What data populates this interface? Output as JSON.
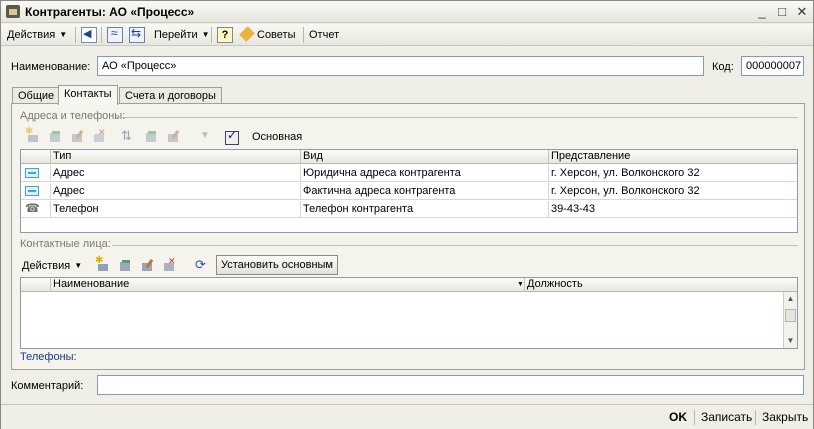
{
  "window": {
    "title": "Контрагенты: АО «Процесс»"
  },
  "toolbar": {
    "actions_label": "Действия",
    "goto_label": "Перейти",
    "help_label": "?",
    "tips_label": "Советы",
    "report_label": "Отчет"
  },
  "form": {
    "name_label": "Наименование:",
    "name_value": "АО «Процесс»",
    "code_label": "Код:",
    "code_value": "000000007",
    "comment_label": "Комментарий:",
    "comment_value": ""
  },
  "tabs": [
    {
      "label": "Общие"
    },
    {
      "label": "Контакты"
    },
    {
      "label": "Счета и договоры"
    }
  ],
  "addresses": {
    "group_title": "Адреса и телефоны:",
    "main_label": "Основная",
    "columns": [
      "Тип",
      "Вид",
      "Представление"
    ],
    "rows": [
      {
        "icon": "address-icon",
        "type": "Адрес",
        "kind": "Юридична адреса контрагента",
        "value": "г. Херсон, ул. Волконского 32"
      },
      {
        "icon": "address-icon",
        "type": "Адрес",
        "kind": "Фактична адреса контрагента",
        "value": "г. Херсон, ул. Волконского 32"
      },
      {
        "icon": "phone-icon",
        "type": "Телефон",
        "kind": "Телефон контрагента",
        "value": "39-43-43"
      }
    ]
  },
  "contacts": {
    "group_title": "Контактные лица:",
    "actions_label": "Действия",
    "set_main_label": "Установить основным",
    "columns": [
      "Наименование",
      "Должность"
    ],
    "phones_label": "Телефоны:"
  },
  "footer": {
    "ok_label": "OK",
    "save_label": "Записать",
    "close_label": "Закрыть"
  }
}
